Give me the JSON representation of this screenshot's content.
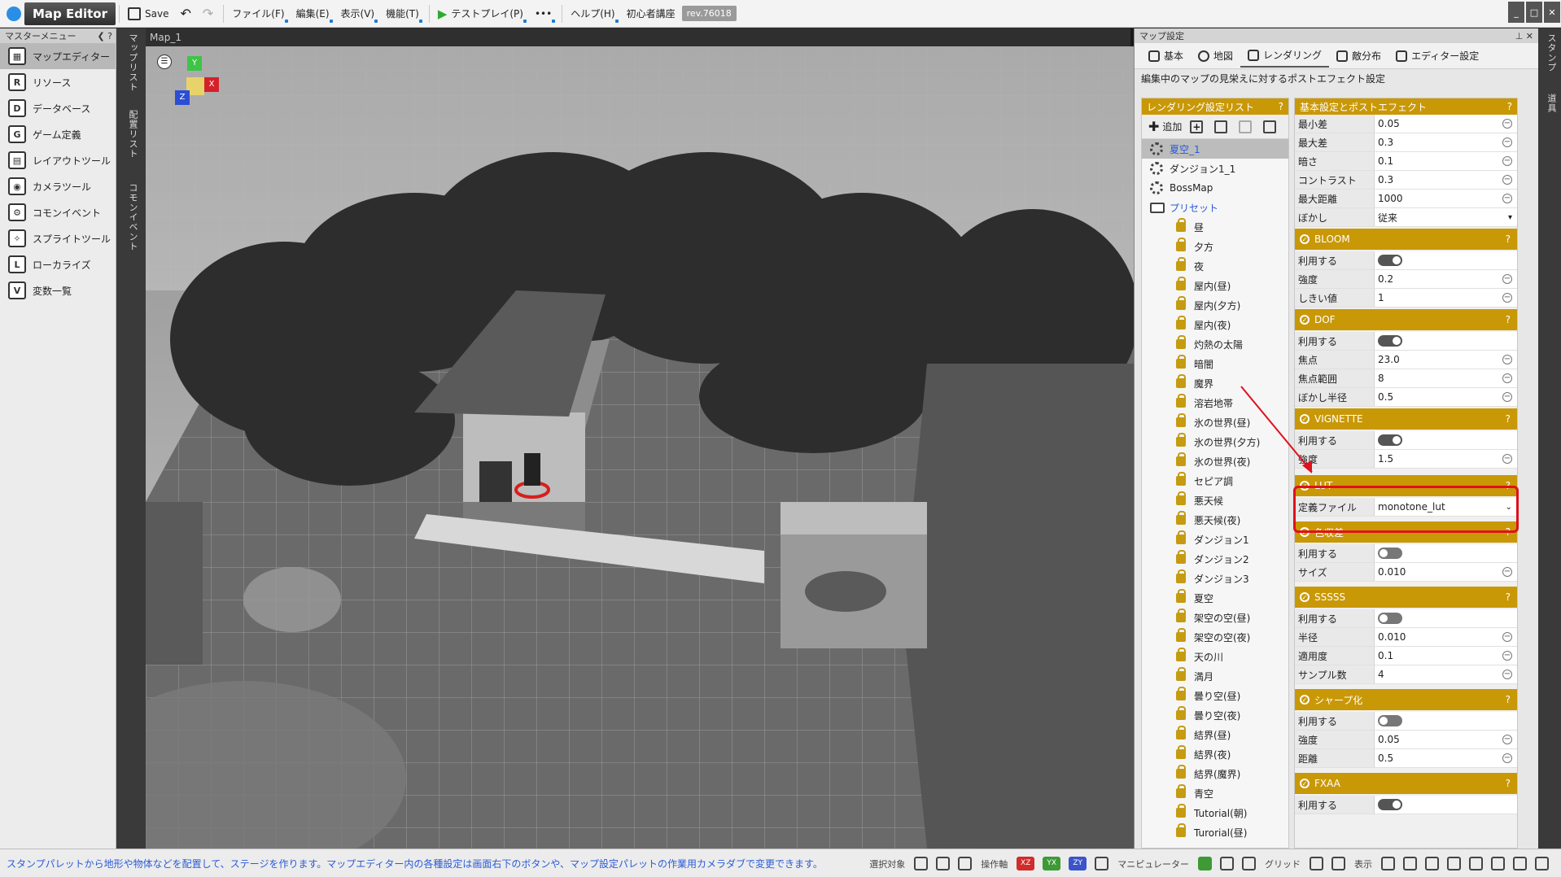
{
  "toolbar": {
    "app_title": "Map Editor",
    "save": "Save",
    "file": "ファイル(F)",
    "edit": "編集(E)",
    "view": "表示(V)",
    "function": "機能(T)",
    "test_play": "テストプレイ(P)",
    "more": "•••",
    "help": "ヘルプ(H)",
    "beginner": "初心者講座",
    "revision": "rev.76018"
  },
  "left_menu": {
    "header": "マスターメニュー",
    "items": [
      {
        "label": "マップエディター",
        "active": true
      },
      {
        "label": "リソース"
      },
      {
        "label": "データベース"
      },
      {
        "label": "ゲーム定義"
      },
      {
        "label": "レイアウトツール"
      },
      {
        "label": "カメラツール"
      },
      {
        "label": "コモンイベント"
      },
      {
        "label": "スプライトツール"
      },
      {
        "label": "ローカライズ"
      },
      {
        "label": "変数一覧"
      }
    ]
  },
  "vertical_tabs": [
    "マップリスト",
    "配置リスト",
    "コモンイベント"
  ],
  "viewport": {
    "title": "Map_1",
    "gizmo": {
      "y": "Y",
      "z": "Z",
      "x": "X"
    }
  },
  "right_panel": {
    "header": "マップ設定",
    "tabs": [
      "基本",
      "地図",
      "レンダリング",
      "敵分布",
      "エディター設定"
    ],
    "active_tab": "レンダリング",
    "description": "編集中のマップの見栄えに対するポストエフェクト設定",
    "render_list": {
      "header": "レンダリング設定リスト",
      "add": "追加",
      "items": [
        "夏空_1",
        "ダンジョン1_1",
        "BossMap"
      ],
      "folder": "プリセット",
      "presets": [
        "昼",
        "夕方",
        "夜",
        "屋内(昼)",
        "屋内(夕方)",
        "屋内(夜)",
        "灼熱の太陽",
        "暗闇",
        "魔界",
        "溶岩地帯",
        "氷の世界(昼)",
        "氷の世界(夕方)",
        "氷の世界(夜)",
        "セピア調",
        "悪天候",
        "悪天候(夜)",
        "ダンジョン1",
        "ダンジョン2",
        "ダンジョン3",
        "夏空",
        "架空の空(昼)",
        "架空の空(夜)",
        "天の川",
        "満月",
        "曇り空(昼)",
        "曇り空(夜)",
        "結界(昼)",
        "結界(夜)",
        "結界(魔界)",
        "青空",
        "Tutorial(朝)",
        "Turorial(昼)"
      ]
    },
    "props": {
      "header": "基本設定とポストエフェクト",
      "basic": [
        {
          "k": "最小差",
          "v": "0.05"
        },
        {
          "k": "最大差",
          "v": "0.3"
        },
        {
          "k": "暗さ",
          "v": "0.1"
        },
        {
          "k": "コントラスト",
          "v": "0.3"
        },
        {
          "k": "最大距離",
          "v": "1000"
        },
        {
          "k": "ぼかし",
          "v": "従来"
        }
      ],
      "use_label": "利用する",
      "bloom": {
        "title": "BLOOM",
        "rows": [
          {
            "k": "強度",
            "v": "0.2"
          },
          {
            "k": "しきい値",
            "v": "1"
          }
        ]
      },
      "dof": {
        "title": "DOF",
        "rows": [
          {
            "k": "焦点",
            "v": "23.0"
          },
          {
            "k": "焦点範囲",
            "v": "8"
          },
          {
            "k": "ぼかし半径",
            "v": "0.5"
          }
        ]
      },
      "vignette": {
        "title": "VIGNETTE",
        "rows": [
          {
            "k": "強度",
            "v": "1.5"
          }
        ]
      },
      "lut": {
        "title": "LUT",
        "file_label": "定義ファイル",
        "file_value": "monotone_lut"
      },
      "chroma": {
        "title": "色収差",
        "rows": [
          {
            "k": "サイズ",
            "v": "0.010"
          }
        ]
      },
      "ssss": {
        "title": "SSSSS",
        "rows": [
          {
            "k": "半径",
            "v": "0.010"
          },
          {
            "k": "適用度",
            "v": "0.1"
          },
          {
            "k": "サンプル数",
            "v": "4"
          }
        ]
      },
      "sharpen": {
        "title": "シャープ化",
        "rows": [
          {
            "k": "強度",
            "v": "0.05"
          },
          {
            "k": "距離",
            "v": "0.5"
          }
        ]
      },
      "fxaa": {
        "title": "FXAA"
      }
    }
  },
  "right_strip": [
    "スタンプ",
    "道具"
  ],
  "status": {
    "message": "スタンプパレットから地形や物体などを配置して、ステージを作ります。マップエディター内の各種設定は画面右下のボタンや、マップ設定パレットの作業用カメラダブで変更できます。",
    "select": "選択対象",
    "operation": "操作軸",
    "manipulator": "マニピュレーター",
    "grid": "グリッド",
    "display": "表示",
    "axes": [
      "XZ",
      "YX",
      "ZY"
    ]
  }
}
